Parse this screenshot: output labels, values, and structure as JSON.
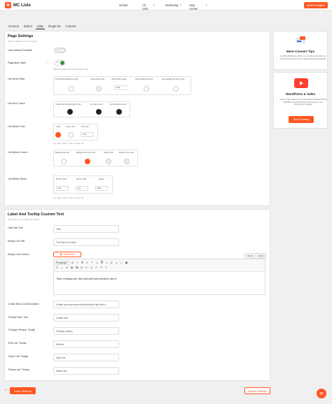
{
  "app": {
    "name": "MC Lists",
    "logo_glyph": "M"
  },
  "topnav": {
    "items": [
      "Global",
      "All Lists",
      "Marketing",
      "Help Center"
    ],
    "quick_support": "Quick support"
  },
  "tabs": [
    "General",
    "Button",
    "Lists",
    "Single list",
    "Counter"
  ],
  "page_settings": {
    "title": "Page Settings",
    "subtitle": "Choose details of your list page.",
    "default_template_label": "Lists Default Template",
    "pagination_label": "Pagination Style",
    "pagination_toggle_text": "On",
    "pagination_hint": "Select list page style for pagination type.",
    "item_style_label": "List Items Style",
    "item_style_cols": [
      "Thumbnail background color",
      "Card border color",
      "Card border radius",
      "Item background color",
      "Item background hover color"
    ],
    "item_style_radius": "10px",
    "text_colors_label": "List Text Colors",
    "text_colors_cols": [
      "Create new list description color",
      "List name color",
      "List description color"
    ],
    "btn_text_label": "List Button Text",
    "btn_text_cols": [
      "Color",
      "Hover color",
      "Font size"
    ],
    "btn_text_size": "14px",
    "btn_text_hint": "e.g. 12px, 13mm, 1em or 1rem, etc",
    "btn_colors_label": "List Button Colors",
    "btn_colors_cols": [
      "Background color",
      "Background hover color",
      "Border color",
      "Border hover color"
    ],
    "btn_sizes_label": "List Button Sizes",
    "btn_sizes_cols": [
      "Border radius",
      "Border width",
      "Height"
    ],
    "btn_sizes_values": [
      "5px",
      "1px",
      "30px"
    ],
    "btn_sizes_hint": "e.g. 12px, 13mm, 1em or 1rem, etc",
    "colors": {
      "accent": "#ff5722",
      "dark": "#222222"
    }
  },
  "label_section": {
    "title": "Label And Tooltip Custom Text",
    "subtitle": "Edit texts on the tooltip and labels.",
    "lists_tab_text_label": "Lists Tab Text",
    "lists_tab_text_value": "Lists",
    "empty_title_label": "Empty List Title",
    "empty_title_value": "You Have No Lists!",
    "empty_content_label": "Empty List Content",
    "add_media": "Add Media",
    "editor_tab_visual": "Visual",
    "editor_tab_text": "Text",
    "editor_paragraph": "Paragraph",
    "editor_content": "Start creating your lists and add some products into it.",
    "create_desc_label": "Create New List Description",
    "create_desc_value": "Create your personal collections and lists and s",
    "create_new_label": "\"Create New\" Text",
    "create_new_value": "Create new",
    "change_privacy_label": "\"Change Privacy\" Tooltip",
    "change_privacy_value": "Change privacy",
    "edit_list_label": "\"Edit List\" Tooltip",
    "edit_list_value": "Edit list",
    "open_list_label": "\"Open List\" Tooltip",
    "open_list_value": "Open list",
    "delete_list_label": "\"Delete List\" Tooltip",
    "delete_list_value": "Delete list"
  },
  "sidebar": {
    "convert": {
      "title": "More Convert Tips",
      "desc": "Let MC Wishlist be active on your site for at least one month and then boost your sales through its analytics."
    },
    "wp": {
      "title": "WordPress & Sales",
      "desc": "Learn 3 new videos every week about troubleshooting WordPress and increasing revenue from your eCommerce website.",
      "button": "Start Growing"
    }
  },
  "footer": {
    "collapse": "«",
    "save": "Save Settings",
    "reset": "Reset Settings",
    "chat_icon": "chat-icon"
  }
}
